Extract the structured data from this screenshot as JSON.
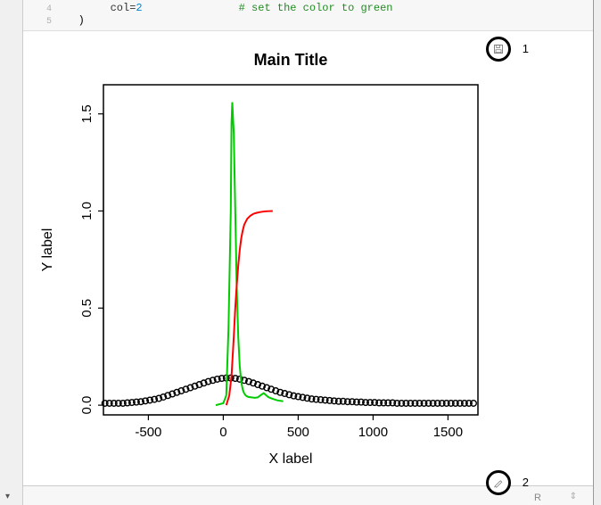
{
  "code": {
    "line4_no": "4",
    "line4_arg": "col",
    "line4_val": "2",
    "line4_comment": "# set the color to green",
    "line5_no": "5",
    "line5_text": ")"
  },
  "toolbar": {
    "save_idx": "1",
    "edit_idx": "2"
  },
  "footer": {
    "lang": "R",
    "handle": "⇕"
  },
  "chart_data": {
    "type": "line",
    "title": "Main Title",
    "xlabel": "X label",
    "ylabel": "Y label",
    "xlim": [
      -800,
      1700
    ],
    "ylim": [
      -0.05,
      1.65
    ],
    "xticks": [
      -500,
      0,
      500,
      1000,
      1500
    ],
    "yticks": [
      0.0,
      0.5,
      1.0,
      1.5
    ],
    "series": [
      {
        "name": "black-markers",
        "color": "#000000",
        "style": "open-circle",
        "x": [
          -790,
          -760,
          -730,
          -700,
          -670,
          -640,
          -610,
          -580,
          -550,
          -520,
          -490,
          -460,
          -430,
          -400,
          -370,
          -340,
          -310,
          -280,
          -250,
          -220,
          -190,
          -160,
          -130,
          -100,
          -70,
          -40,
          -10,
          20,
          50,
          80,
          110,
          140,
          170,
          200,
          230,
          260,
          290,
          320,
          350,
          380,
          410,
          440,
          470,
          500,
          530,
          560,
          590,
          620,
          650,
          680,
          710,
          740,
          770,
          800,
          830,
          860,
          890,
          920,
          950,
          980,
          1010,
          1040,
          1070,
          1100,
          1130,
          1160,
          1190,
          1220,
          1250,
          1280,
          1310,
          1340,
          1370,
          1400,
          1430,
          1460,
          1490,
          1520,
          1550,
          1580,
          1610,
          1640,
          1670
        ],
        "y": [
          0.01,
          0.01,
          0.01,
          0.01,
          0.01,
          0.012,
          0.014,
          0.016,
          0.018,
          0.022,
          0.026,
          0.03,
          0.035,
          0.042,
          0.05,
          0.058,
          0.066,
          0.074,
          0.082,
          0.09,
          0.098,
          0.106,
          0.114,
          0.122,
          0.128,
          0.134,
          0.138,
          0.14,
          0.14,
          0.138,
          0.134,
          0.128,
          0.122,
          0.114,
          0.106,
          0.098,
          0.09,
          0.082,
          0.074,
          0.066,
          0.06,
          0.054,
          0.048,
          0.044,
          0.04,
          0.036,
          0.032,
          0.03,
          0.028,
          0.026,
          0.024,
          0.022,
          0.02,
          0.02,
          0.018,
          0.018,
          0.016,
          0.016,
          0.014,
          0.014,
          0.014,
          0.012,
          0.012,
          0.012,
          0.012,
          0.01,
          0.01,
          0.01,
          0.01,
          0.01,
          0.01,
          0.01,
          0.01,
          0.01,
          0.01,
          0.01,
          0.01,
          0.01,
          0.01,
          0.01,
          0.01,
          0.01,
          0.01
        ]
      },
      {
        "name": "green-line",
        "color": "#00cc00",
        "style": "line",
        "x": [
          -50,
          0,
          20,
          35,
          50,
          55,
          60,
          70,
          80,
          90,
          100,
          110,
          120,
          130,
          140,
          150,
          160,
          170,
          190,
          210,
          230,
          250,
          270,
          300,
          320,
          340,
          360,
          400
        ],
        "y": [
          0.0,
          0.01,
          0.05,
          0.4,
          1.0,
          1.45,
          1.56,
          1.4,
          1.0,
          0.6,
          0.35,
          0.2,
          0.12,
          0.08,
          0.06,
          0.05,
          0.045,
          0.042,
          0.04,
          0.038,
          0.04,
          0.052,
          0.062,
          0.042,
          0.035,
          0.03,
          0.025,
          0.02
        ]
      },
      {
        "name": "red-line",
        "color": "#ff0000",
        "style": "line",
        "x": [
          20,
          40,
          55,
          70,
          80,
          90,
          100,
          110,
          120,
          130,
          140,
          160,
          180,
          200,
          220,
          250,
          280,
          300,
          330
        ],
        "y": [
          0.0,
          0.05,
          0.15,
          0.35,
          0.5,
          0.62,
          0.72,
          0.8,
          0.86,
          0.9,
          0.93,
          0.96,
          0.975,
          0.985,
          0.99,
          0.995,
          0.998,
          0.999,
          1.0
        ]
      }
    ]
  }
}
